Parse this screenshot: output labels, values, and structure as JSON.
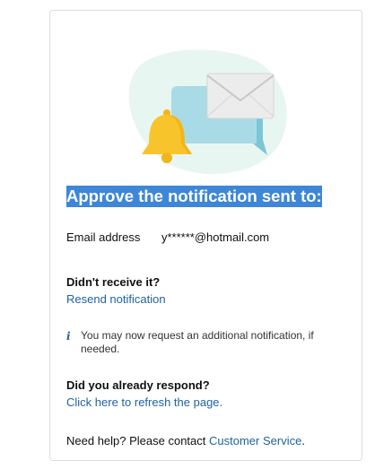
{
  "heading": "Approve the notification sent to:",
  "email": {
    "label": "Email address",
    "value": "y******@hotmail.com"
  },
  "not_received": {
    "title": "Didn't receive it?",
    "link": "Resend notification"
  },
  "info": {
    "icon": "info-icon",
    "text": "You may now request an additional notification, if needed."
  },
  "responded": {
    "title": "Did you already respond?",
    "link": "Click here to refresh the page."
  },
  "help": {
    "text": "Need help? Please contact",
    "link": "Customer Service",
    "suffix": "."
  },
  "colors": {
    "link": "#2162a1",
    "highlight": "#3d86d8",
    "bell": "#f7c52b",
    "bubble": "#a9dbe6",
    "blob": "#e8f6f2"
  }
}
